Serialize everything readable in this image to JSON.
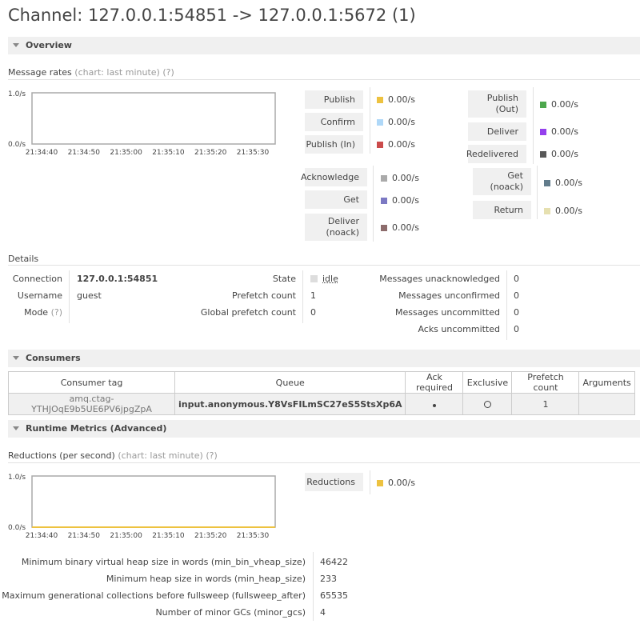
{
  "page": {
    "title": "Channel: 127.0.0.1:54851 -> 127.0.0.1:5672 (1)"
  },
  "overview": {
    "section_label": "Overview",
    "message_rates_label": "Message rates",
    "chart_hint": "(chart: last minute)",
    "help": "(?)"
  },
  "chart_data": [
    {
      "type": "line",
      "title": "Message rates",
      "x": [
        "21:34:40",
        "21:34:50",
        "21:35:00",
        "21:35:10",
        "21:35:20",
        "21:35:30"
      ],
      "ylim": [
        0,
        1
      ],
      "y_ticks": [
        "1.0/s",
        "0.0/s"
      ],
      "series": [
        {
          "values": [
            0,
            0,
            0,
            0,
            0,
            0
          ]
        }
      ],
      "grid": false
    },
    {
      "type": "line",
      "title": "Reductions (per second)",
      "x": [
        "21:34:40",
        "21:34:50",
        "21:35:00",
        "21:35:10",
        "21:35:20",
        "21:35:30"
      ],
      "ylim": [
        0,
        1
      ],
      "y_ticks": [
        "1.0/s",
        "0.0/s"
      ],
      "series": [
        {
          "values": [
            0,
            0,
            0,
            0,
            0,
            0
          ],
          "color": "#edc240"
        }
      ],
      "grid": false
    }
  ],
  "rates": {
    "publish": {
      "label": "Publish",
      "value": "0.00/s",
      "color": "#edc240"
    },
    "confirm": {
      "label": "Confirm",
      "value": "0.00/s",
      "color": "#afd8f8"
    },
    "publish_in": {
      "label": "Publish (In)",
      "value": "0.00/s",
      "color": "#cb4b4b"
    },
    "publish_out": {
      "label1": "Publish",
      "label2": "(Out)",
      "value": "0.00/s",
      "color": "#4da74d"
    },
    "deliver": {
      "label": "Deliver",
      "value": "0.00/s",
      "color": "#9440ed"
    },
    "redelivered": {
      "label": "Redelivered",
      "value": "0.00/s",
      "color": "#585858"
    },
    "acknowledge": {
      "label": "Acknowledge",
      "value": "0.00/s",
      "color": "#aaaaaa"
    },
    "get": {
      "label": "Get",
      "value": "0.00/s",
      "color": "#7c79c3"
    },
    "deliver_noack": {
      "label1": "Deliver",
      "label2": "(noack)",
      "value": "0.00/s",
      "color": "#8d6c6c"
    },
    "get_noack": {
      "label1": "Get",
      "label2": "(noack)",
      "value": "0.00/s",
      "color": "#627c8c"
    },
    "return": {
      "label": "Return",
      "value": "0.00/s",
      "color": "#e6e0b0"
    }
  },
  "details": {
    "heading": "Details",
    "connection_label": "Connection",
    "connection_value": "127.0.0.1:54851",
    "username_label": "Username",
    "username_value": "guest",
    "mode_label": "Mode",
    "mode_help": "(?)",
    "state_label": "State",
    "state_value": "idle",
    "prefetch_label": "Prefetch count",
    "prefetch_value": "1",
    "global_prefetch_label": "Global prefetch count",
    "global_prefetch_value": "0",
    "msgs_unacked_label": "Messages unacknowledged",
    "msgs_unacked_value": "0",
    "msgs_unconfirmed_label": "Messages unconfirmed",
    "msgs_unconfirmed_value": "0",
    "msgs_uncommitted_label": "Messages uncommitted",
    "msgs_uncommitted_value": "0",
    "acks_uncommitted_label": "Acks uncommitted",
    "acks_uncommitted_value": "0"
  },
  "consumers": {
    "section_label": "Consumers",
    "headers": [
      "Consumer tag",
      "Queue",
      "Ack required",
      "Exclusive",
      "Prefetch count",
      "Arguments"
    ],
    "row": {
      "consumer_tag": "amq.ctag-YTHJOqE9b5UE6PV6jpgZpA",
      "queue": "input.anonymous.Y8VsFILmSC27eS5StsXp6A",
      "ack_required": true,
      "exclusive": false,
      "prefetch_count": "1",
      "arguments": ""
    }
  },
  "runtime": {
    "section_label": "Runtime Metrics (Advanced)",
    "reductions_label": "Reductions (per second)",
    "chart_hint": "(chart: last minute)",
    "help": "(?)",
    "reductions_rate": {
      "label": "Reductions",
      "value": "0.00/s",
      "color": "#edc240"
    },
    "metrics": [
      {
        "label": "Minimum binary virtual heap size in words (min_bin_vheap_size)",
        "value": "46422"
      },
      {
        "label": "Minimum heap size in words (min_heap_size)",
        "value": "233"
      },
      {
        "label": "Maximum generational collections before fullsweep (fullsweep_after)",
        "value": "65535"
      },
      {
        "label": "Number of minor GCs (minor_gcs)",
        "value": "4"
      }
    ]
  }
}
